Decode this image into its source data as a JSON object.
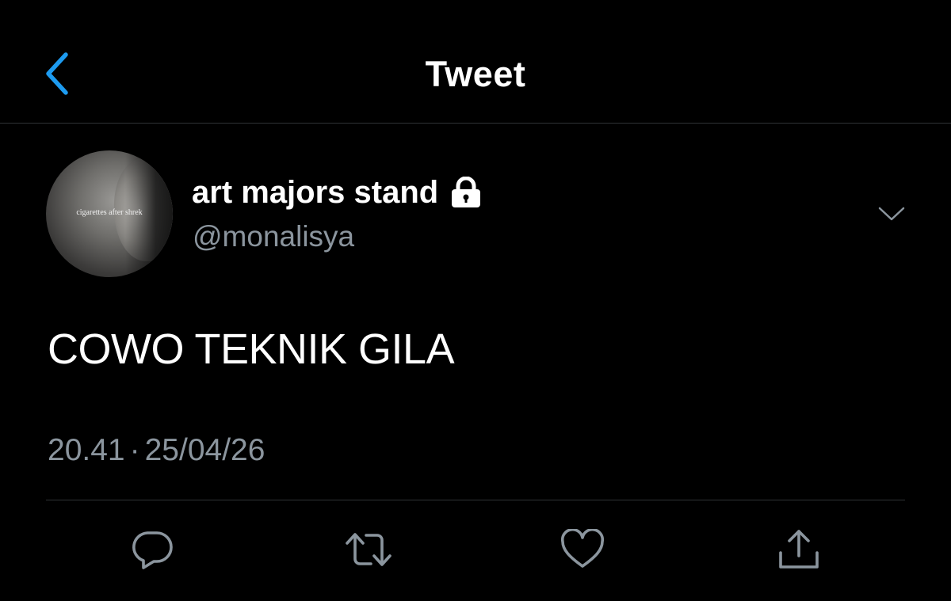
{
  "header": {
    "title": "Tweet",
    "back_icon": "chevron-left-icon",
    "accent_color": "#1d9bf0"
  },
  "tweet": {
    "avatar_caption": "cigarettes after shrek",
    "display_name": "art majors stand",
    "protected_icon": "lock-icon",
    "handle": "@monalisya",
    "text": "COWO TEKNIK GILA",
    "time": "20.41",
    "separator": "·",
    "date": "25/04/26",
    "menu_icon": "chevron-down-icon"
  },
  "actions": [
    {
      "name": "reply",
      "icon": "comment-icon"
    },
    {
      "name": "retweet",
      "icon": "retweet-icon"
    },
    {
      "name": "like",
      "icon": "heart-icon"
    },
    {
      "name": "share",
      "icon": "share-icon"
    }
  ],
  "colors": {
    "background": "#000000",
    "text": "#ffffff",
    "secondary_text": "#8b959e",
    "divider": "#2f3336",
    "icon": "#8b959e"
  }
}
